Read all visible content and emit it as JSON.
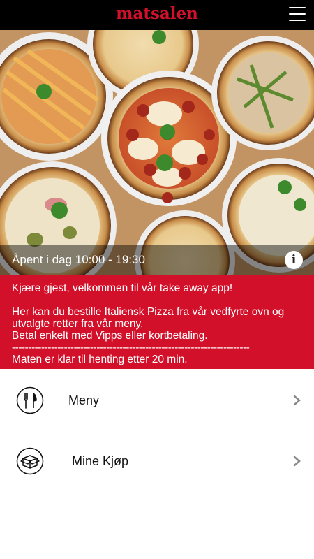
{
  "header": {
    "logo_text": "matsalen",
    "menu_icon": "hamburger-menu-icon",
    "brand_color": "#d3102a"
  },
  "hero": {
    "hours_text": "Åpent i dag 10:00 - 19:30",
    "info_label": "i",
    "info_icon": "info-icon"
  },
  "welcome": {
    "line1": "Kjære gjest, velkommen til vår take away app!",
    "line2": "Her kan du bestille Italiensk Pizza fra vår vedfyrte ovn og",
    "line3": "utvalgte retter fra vår meny.",
    "line4": "Betal enkelt med Vipps eller kortbetaling.",
    "separator": "-------------------------------------------------------------------------",
    "line5": "Maten er klar til henting etter 20 min."
  },
  "nav": [
    {
      "label": "Meny",
      "icon": "cutlery-icon"
    },
    {
      "label": "Mine Kjøp",
      "icon": "box-icon"
    }
  ]
}
